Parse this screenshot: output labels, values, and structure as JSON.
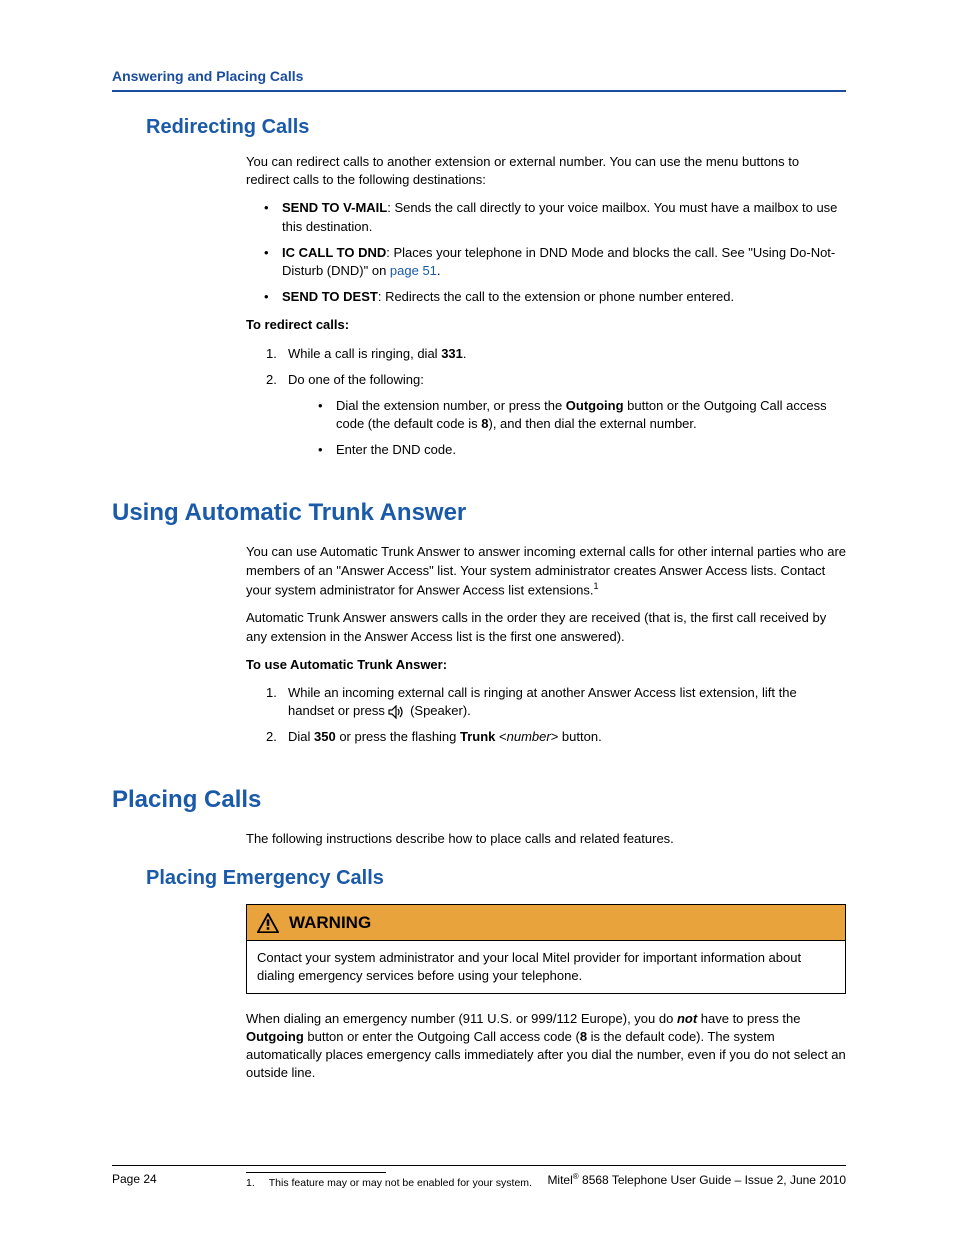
{
  "header": {
    "running_head": "Answering and Placing Calls"
  },
  "redirecting": {
    "title": "Redirecting Calls",
    "intro": "You can redirect calls to another extension or external number. You can use the menu buttons to redirect calls to the following destinations:",
    "items": [
      {
        "label": "SEND TO V-MAIL",
        "text": ": Sends the call directly to your voice mailbox. You must have a mailbox to use this destination."
      },
      {
        "label": "IC CALL TO DND",
        "text_pre": ": Places your telephone in DND Mode and blocks the call. See \"Using Do-Not-Disturb (DND)\" on ",
        "link": "page 51",
        "text_post": "."
      },
      {
        "label": "SEND TO DEST",
        "text": ": Redirects the call to the extension or phone number entered."
      }
    ],
    "howto_label": "To redirect calls:",
    "steps": {
      "s1_pre": "While a call is ringing, dial ",
      "s1_code": "331",
      "s1_post": ".",
      "s2": "Do one of the following:",
      "s2a_pre": "Dial the extension number, or press the ",
      "s2a_b1": "Outgoing",
      "s2a_mid": " button or the Outgoing Call access code (the default code is ",
      "s2a_b2": "8",
      "s2a_post": "), and then dial the external number.",
      "s2b": "Enter the DND code."
    }
  },
  "trunk": {
    "title": "Using Automatic Trunk Answer",
    "p1": "You can use Automatic Trunk Answer to answer incoming external calls for other internal parties who are members of an \"Answer Access\" list. Your system administrator creates Answer Access lists. Contact your system administrator for Answer Access list extensions.",
    "sup": "1",
    "p2": "Automatic Trunk Answer answers calls in the order they are received (that is, the first call received by any extension in the Answer Access list is the first one answered).",
    "howto_label": "To use Automatic Trunk Answer:",
    "s1_pre": "While an incoming external call is ringing at another Answer Access list extension, lift the handset or press ",
    "s1_post": " (Speaker).",
    "s2_pre": "Dial ",
    "s2_b1": "350",
    "s2_mid": " or press the flashing ",
    "s2_b2": "Trunk",
    "s2_it_pre": " <",
    "s2_it": "number",
    "s2_it_post": "> button."
  },
  "placing": {
    "title": "Placing Calls",
    "intro": "The following instructions describe how to place calls and related features."
  },
  "emergency": {
    "title": "Placing Emergency Calls",
    "warn_label": "WARNING",
    "warn_body": "Contact your system administrator and your local Mitel provider for important information about dialing emergency services before using your telephone.",
    "p_pre": "When dialing an emergency number (911 U.S. or 999/112 Europe), you do ",
    "p_not": "not",
    "p_mid1": " have to press the ",
    "p_b1": "Outgoing",
    "p_mid2": " button or enter the Outgoing Call access code (",
    "p_b2": "8",
    "p_post": " is the default code). The system automatically places emergency calls immediately after you dial the number, even if you do not select an outside line."
  },
  "footnote": {
    "num": "1.",
    "text": "This feature may or may not be enabled for your system."
  },
  "footer": {
    "left": "Page 24",
    "right_pre": "Mitel",
    "right_reg": "®",
    "right_post": " 8568 Telephone User Guide – Issue 2, June 2010"
  }
}
